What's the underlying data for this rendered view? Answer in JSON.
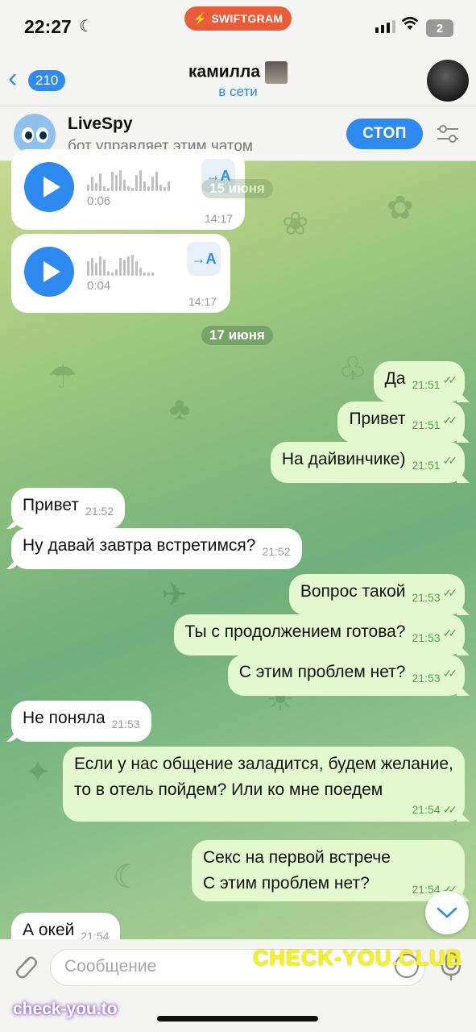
{
  "status_bar": {
    "time": "22:27",
    "badge": "SWIFTGRAM",
    "battery": "2"
  },
  "header": {
    "back_count": "210",
    "contact_name": "камилла",
    "contact_status": "в сети"
  },
  "bot_bar": {
    "name": "LiveSpy",
    "description": "бот управляет этим чатом",
    "stop_label": "СТОП"
  },
  "voice_messages": [
    {
      "duration": "0:06",
      "time": "14:17",
      "translate": "→A"
    },
    {
      "duration": "0:04",
      "time": "14:17",
      "translate": "→A"
    }
  ],
  "date_separators": [
    "15 июня",
    "17 июня"
  ],
  "messages": [
    {
      "dir": "out",
      "text": "Да",
      "time": "21:51"
    },
    {
      "dir": "out",
      "text": "Привет",
      "time": "21:51"
    },
    {
      "dir": "out",
      "text": "На дайвинчике)",
      "time": "21:51"
    },
    {
      "dir": "in",
      "text": "Привет",
      "time": "21:52"
    },
    {
      "dir": "in",
      "text": "Ну давай завтра встретимся?",
      "time": "21:52"
    },
    {
      "dir": "out",
      "text": "Вопрос такой",
      "time": "21:53"
    },
    {
      "dir": "out",
      "text": "Ты с продолжением готова?",
      "time": "21:53"
    },
    {
      "dir": "out",
      "text": "С этим проблем нет?",
      "time": "21:53"
    },
    {
      "dir": "in",
      "text": "Не поняла",
      "time": "21:53"
    },
    {
      "dir": "out",
      "text": "Если у нас общение заладится, будем желание, то в отель пойдем? Или ко мне поедем",
      "time": "21:54"
    },
    {
      "dir": "out",
      "text": "Секс на первой встрече\nС этим проблем нет?",
      "time": "21:54"
    },
    {
      "dir": "in",
      "text": "А окей",
      "time": "21:54"
    }
  ],
  "composer": {
    "placeholder": "Сообщение"
  },
  "watermarks": [
    "CHECK-YOU.CLUB",
    "check-you.to"
  ]
}
